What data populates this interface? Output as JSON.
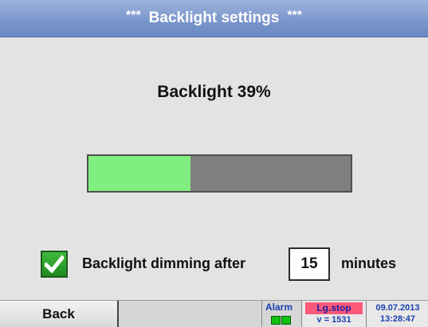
{
  "title": {
    "stars_left": "***",
    "text": "Backlight settings",
    "stars_right": "***"
  },
  "backlight": {
    "label": "Backlight 39%",
    "level_percent": 39
  },
  "dimming": {
    "checked": true,
    "label": "Backlight dimming after",
    "value": "15",
    "unit_label": "minutes"
  },
  "footer": {
    "back_label": "Back",
    "alarm_label": "Alarm",
    "log_status": "Lg.stop",
    "log_value": "v = 1531",
    "date": "09.07.2013",
    "time": "13:28:47"
  },
  "colors": {
    "title_bar": "#7b97cc",
    "bar_fill": "#80ef80",
    "bar_track": "#7f7f7f",
    "checkbox": "#2a9e2a",
    "alarm_led": "#10c010",
    "log_stop_bg": "#ff5a7a"
  }
}
